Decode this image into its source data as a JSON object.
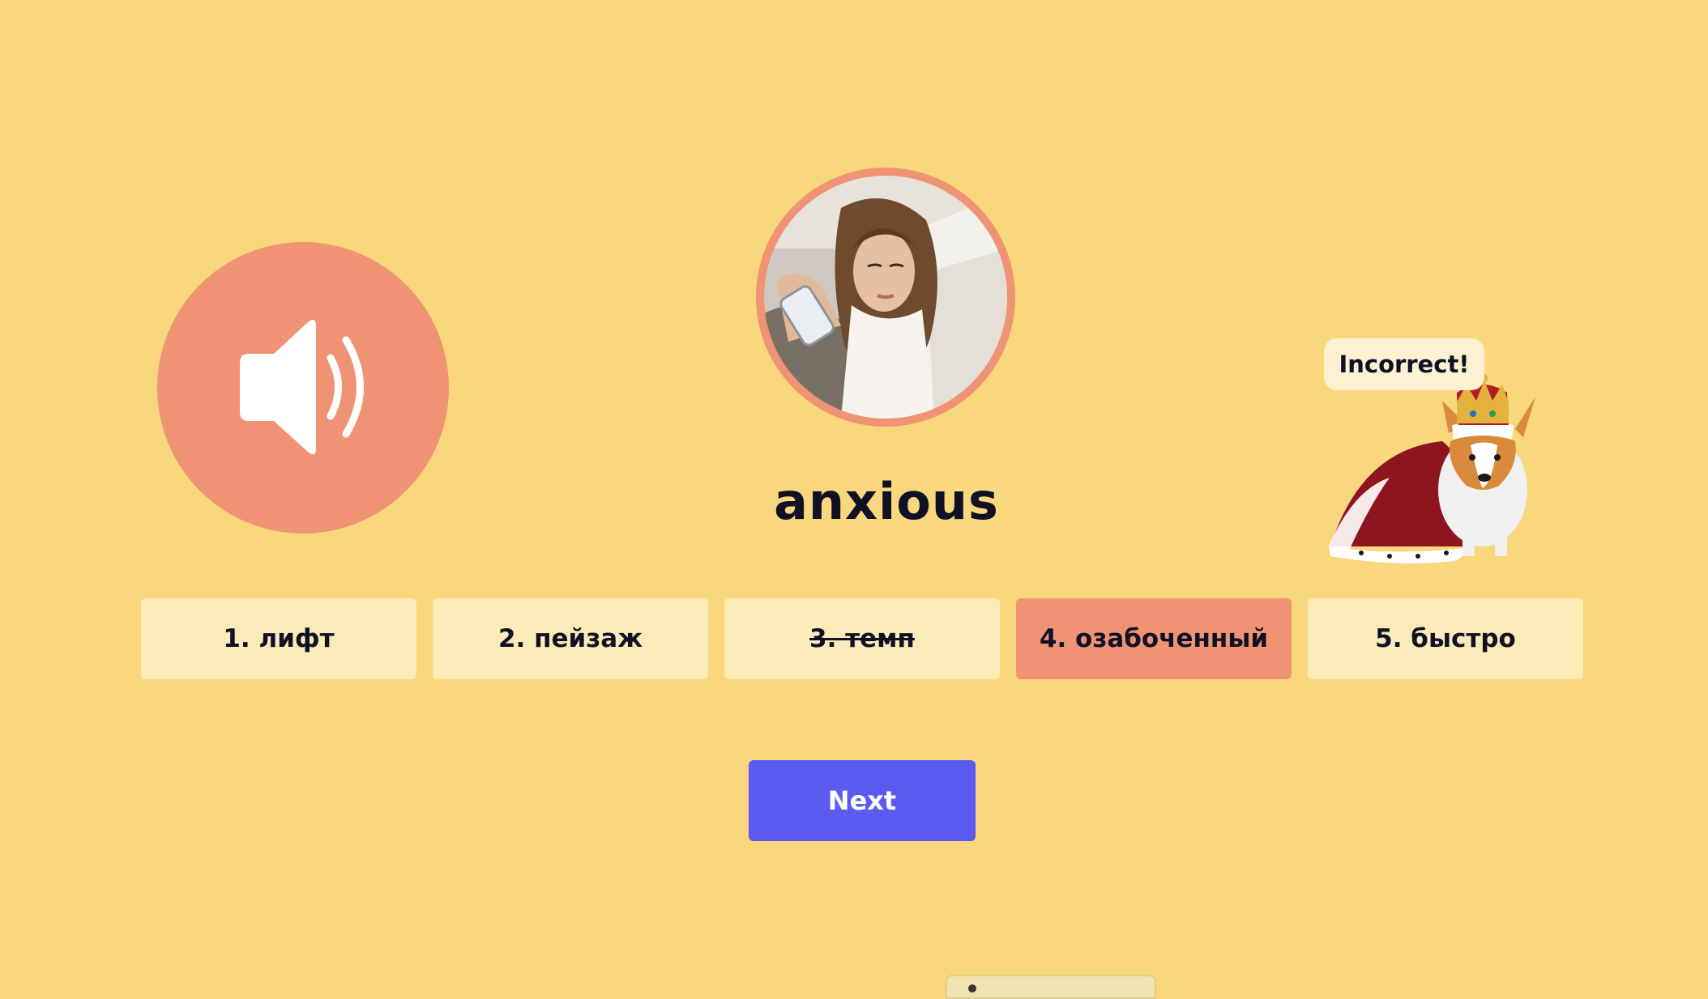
{
  "word": "anxious",
  "feedback": "Incorrect!",
  "options": [
    {
      "label": "1. лифт",
      "state": "default"
    },
    {
      "label": "2. пейзаж",
      "state": "default"
    },
    {
      "label": "3. темп",
      "state": "struck"
    },
    {
      "label": "4. озабоченный",
      "state": "selected"
    },
    {
      "label": "5. быстро",
      "state": "default"
    }
  ],
  "next_label": "Next",
  "audio_icon": "speaker-icon",
  "colors": {
    "background": "#F8D77D",
    "accent": "#F09374",
    "option": "#FBEBB8",
    "button": "#5B5BF2",
    "text": "#111126"
  }
}
